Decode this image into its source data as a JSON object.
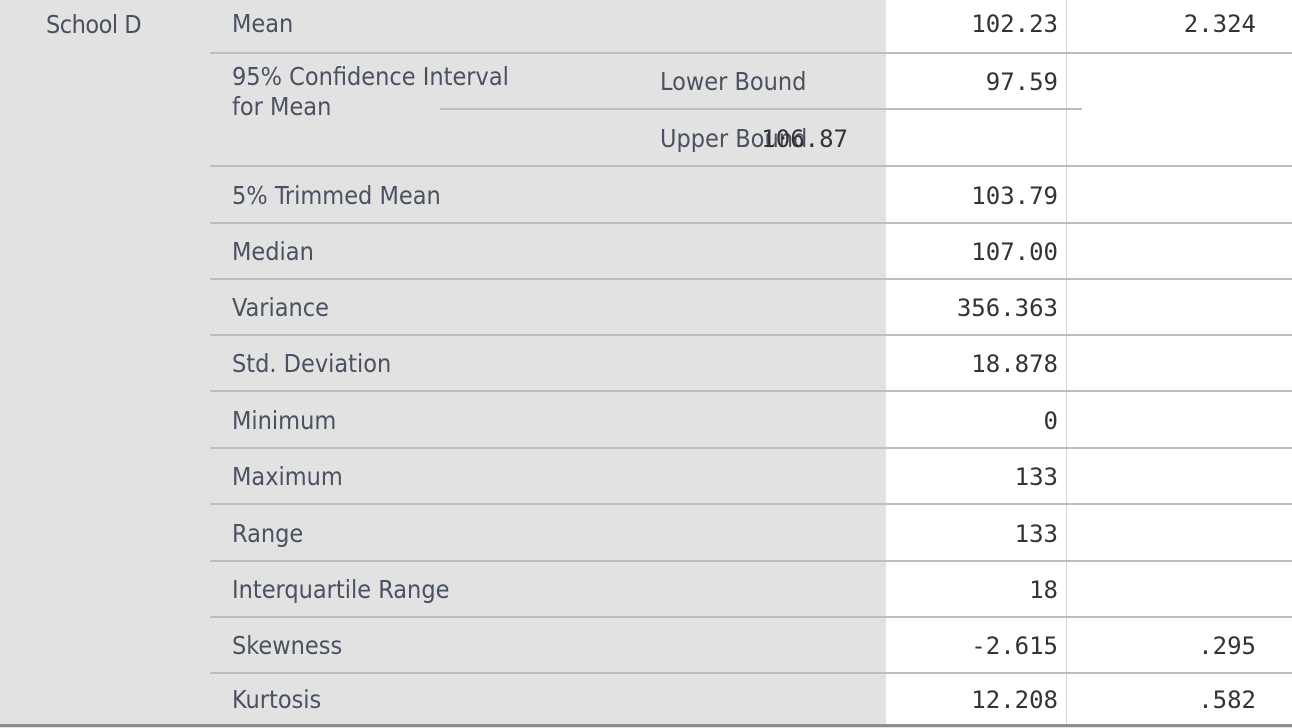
{
  "table": {
    "group": "School D",
    "rows": [
      {
        "label": "Mean",
        "sublabel": "",
        "statistic": "102.23",
        "std_error": "2.324"
      },
      {
        "label": "95% Confidence Interval for Mean",
        "sublabel": "Lower Bound",
        "statistic": "97.59",
        "std_error": ""
      },
      {
        "label": "",
        "sublabel": "Upper Bound",
        "statistic": "106.87",
        "std_error": ""
      },
      {
        "label": "5% Trimmed Mean",
        "sublabel": "",
        "statistic": "103.79",
        "std_error": ""
      },
      {
        "label": "Median",
        "sublabel": "",
        "statistic": "107.00",
        "std_error": ""
      },
      {
        "label": "Variance",
        "sublabel": "",
        "statistic": "356.363",
        "std_error": ""
      },
      {
        "label": "Std. Deviation",
        "sublabel": "",
        "statistic": "18.878",
        "std_error": ""
      },
      {
        "label": "Minimum",
        "sublabel": "",
        "statistic": "0",
        "std_error": ""
      },
      {
        "label": "Maximum",
        "sublabel": "",
        "statistic": "133",
        "std_error": ""
      },
      {
        "label": "Range",
        "sublabel": "",
        "statistic": "133",
        "std_error": ""
      },
      {
        "label": "Interquartile Range",
        "sublabel": "",
        "statistic": "18",
        "std_error": ""
      },
      {
        "label": "Skewness",
        "sublabel": "",
        "statistic": "-2.615",
        "std_error": ".295"
      },
      {
        "label": "Kurtosis",
        "sublabel": "",
        "statistic": "12.208",
        "std_error": ".582"
      }
    ],
    "ci_label_line1": "95% Confidence Interval",
    "ci_label_line2": "for Mean"
  }
}
